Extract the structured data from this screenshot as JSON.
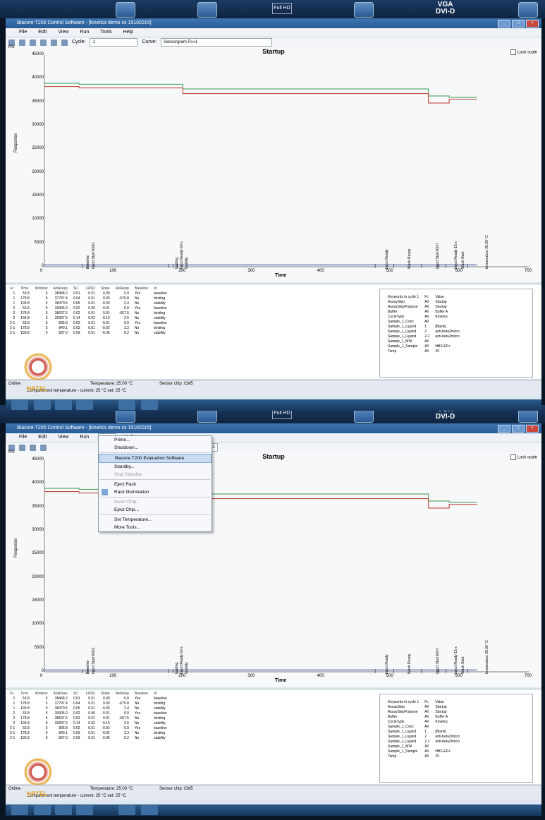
{
  "device_bar": {
    "full_hd": "Full HD",
    "vga": "VGA",
    "dvi": "DVI-D"
  },
  "window": {
    "title": "Biacore T200 Control Software - [kinetics demo cs 15102015]"
  },
  "menus": [
    "File",
    "Edit",
    "View",
    "Run",
    "Tools",
    "Help"
  ],
  "toolbar": {
    "cycle_label": "Cycle:",
    "cycle_value": "1",
    "curve_label": "Curve:",
    "curve_value": "Sensorgram Fc=1",
    "curve_value_short": "gram Fc=1"
  },
  "plot": {
    "title": "Startup",
    "lock_scale": "Lock scale",
    "unit": "RU",
    "ylabel": "Response",
    "xlabel": "Time",
    "yticks": [
      "45000",
      "40000",
      "35000",
      "30000",
      "25000",
      "20000",
      "15000",
      "10000",
      "5000",
      "0"
    ],
    "xticks": [
      "0",
      "100",
      "200",
      "300",
      "400",
      "500",
      "600",
      "700"
    ]
  },
  "chart_data": {
    "type": "line",
    "title": "Startup",
    "xlabel": "Time",
    "ylabel": "Response",
    "xlim": [
      0,
      700
    ],
    "ylim": [
      0,
      45000
    ],
    "series": [
      {
        "color": "#3a9a50",
        "x": [
          0,
          50,
          50,
          200,
          200,
          555,
          555,
          585,
          585,
          625
        ],
        "y": [
          39000,
          39000,
          38800,
          38800,
          37800,
          37800,
          36300,
          36300,
          36000,
          36000
        ]
      },
      {
        "color": "#c0392b",
        "x": [
          0,
          50,
          50,
          200,
          200,
          555,
          555,
          585,
          585,
          625
        ],
        "y": [
          38300,
          38300,
          38000,
          38000,
          36800,
          36800,
          34800,
          34800,
          35600,
          35600
        ]
      },
      {
        "color": "#2a3d8f",
        "x": [
          0,
          625
        ],
        "y": [
          400,
          400
        ]
      }
    ],
    "grid": false
  },
  "markers": [
    "Baseline",
    "Inject Start R2E1",
    "binding",
    "Inject Ready 60 s",
    "stability",
    "Inject Ready",
    "Wash Ready",
    "Inject Start R2/rt",
    "Inject Ready 15 s",
    "Wash Start",
    "temperature 25.00 °C"
  ],
  "events": {
    "headers": [
      "Fc",
      "Time",
      "Window",
      "AbsResp",
      "SD",
      "LRSD",
      "Slope",
      "RelResp",
      "Baseline",
      "Id"
    ],
    "rows": [
      [
        "1",
        "53.8",
        "5",
        "38468.2",
        "0.01",
        "0.01",
        "0.00",
        "0.0",
        "Yes",
        "baseline"
      ],
      [
        "1",
        "178.8",
        "5",
        "37797.4",
        "0.04",
        "0.01",
        "0.03",
        "-670.8",
        "No",
        "binding"
      ],
      [
        "1",
        "193.8",
        "5",
        "38470.5",
        "0.05",
        "0.01",
        "-0.03",
        "2.4",
        "No",
        "stability"
      ],
      [
        "2",
        "53.8",
        "5",
        "39305.0",
        "0.02",
        "0.00",
        "-0.01",
        "0.0",
        "Yes",
        "baseline"
      ],
      [
        "2",
        "178.8",
        "5",
        "38637.5",
        "0.02",
        "0.01",
        "0.01",
        "-667.5",
        "No",
        "binding"
      ],
      [
        "2",
        "193.8",
        "5",
        "39307.5",
        "0.14",
        "0.02",
        "-0.10",
        "2.5",
        "No",
        "stability"
      ],
      [
        "2-1",
        "53.8",
        "5",
        "836.8",
        "0.02",
        "0.01",
        "-0.01",
        "0.0",
        "Yes",
        "baseline"
      ],
      [
        "2-1",
        "178.8",
        "5",
        "840.1",
        "0.03",
        "0.01",
        "-0.02",
        "3.3",
        "No",
        "binding"
      ],
      [
        "2-1",
        "193.8",
        "5",
        "837.0",
        "0.09",
        "0.01",
        "-0.06",
        "0.2",
        "No",
        "stability"
      ]
    ]
  },
  "keywords": {
    "headers": [
      "Keywords in cycle 1",
      "Fc",
      "Value"
    ],
    "rows": [
      [
        "AssayStep",
        "All",
        "Startup"
      ],
      [
        "AssayStepPurpose",
        "All",
        "Startup"
      ],
      [
        "Buffer",
        "All",
        "Buffer A"
      ],
      [
        "CycleType",
        "All",
        "Kinetics"
      ],
      [
        "Sample_1_Conc",
        "All",
        ""
      ],
      [
        "Sample_1_Ligand",
        "1",
        "[Blank]"
      ],
      [
        "Sample_1_Ligand",
        "2",
        "anti-beta2micro"
      ],
      [
        "Sample_1_Ligand",
        "2-1",
        "anti-beta2micro"
      ],
      [
        "Sample_1_MW",
        "All",
        ""
      ],
      [
        "Sample_1_Sample",
        "All",
        "HBS-EP+"
      ],
      [
        "Temp",
        "All",
        "25"
      ]
    ]
  },
  "status": {
    "online": "Online",
    "temperature": "Temperature: 25.00 °C",
    "sensor_chip": "Sensor chip: CM5",
    "compartment": "Compartment temperature - current: 25 °C  set: 25 °C",
    "nptel": "NPTEL"
  },
  "tools_menu": {
    "items": [
      "Prime...",
      "Shutdown...",
      "Biacore T200 Evaluation Software",
      "Standby...",
      "Stop Standby",
      "Eject Rack",
      "Rack Illumination",
      "Insert Chip...",
      "Eject Chip...",
      "Set Temperature...",
      "More Tools..."
    ]
  }
}
